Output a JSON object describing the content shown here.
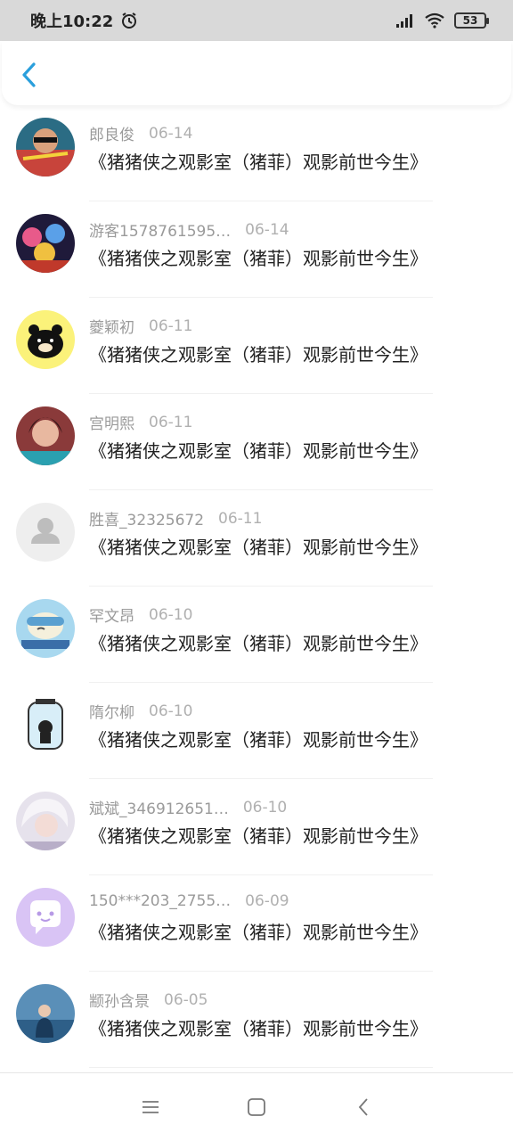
{
  "status_bar": {
    "time": "晚上10:22",
    "battery": "53",
    "icons": [
      "alarm-icon",
      "signal-icon",
      "wifi-icon",
      "battery-icon"
    ]
  },
  "header": {
    "back_icon": "chevron-left-icon",
    "accent_color": "#2a9fdc"
  },
  "list": {
    "items": [
      {
        "name": "郎良俊",
        "date": "06-14",
        "title": "《猪猪侠之观影室（猪菲）观影前世今生》"
      },
      {
        "name": "游客1578761595…",
        "date": "06-14",
        "title": "《猪猪侠之观影室（猪菲）观影前世今生》"
      },
      {
        "name": "夔颖初",
        "date": "06-11",
        "title": "《猪猪侠之观影室（猪菲）观影前世今生》"
      },
      {
        "name": "宫明熙",
        "date": "06-11",
        "title": "《猪猪侠之观影室（猪菲）观影前世今生》"
      },
      {
        "name": "胜喜_32325672",
        "date": "06-11",
        "title": "《猪猪侠之观影室（猪菲）观影前世今生》"
      },
      {
        "name": "罕文昂",
        "date": "06-10",
        "title": "《猪猪侠之观影室（猪菲）观影前世今生》"
      },
      {
        "name": "隋尔柳",
        "date": "06-10",
        "title": "《猪猪侠之观影室（猪菲）观影前世今生》"
      },
      {
        "name": "斌斌_346912651…",
        "date": "06-10",
        "title": "《猪猪侠之观影室（猪菲）观影前世今生》"
      },
      {
        "name": "150***203_2755…",
        "date": "06-09",
        "title": "《猪猪侠之观影室（猪菲）观影前世今生》"
      },
      {
        "name": "颛孙含景",
        "date": "06-05",
        "title": "《猪猪侠之观影室（猪菲）观影前世今生》"
      }
    ]
  },
  "nav_bar": {
    "icons": [
      "menu-icon",
      "home-icon",
      "back-icon"
    ]
  }
}
